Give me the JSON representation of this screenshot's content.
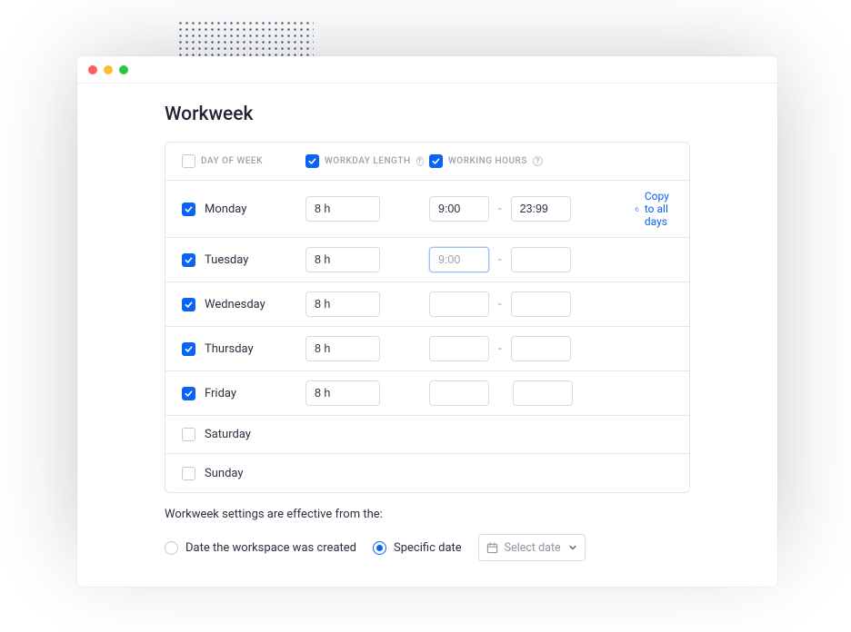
{
  "title": "Workweek",
  "columns": {
    "day": "DAY OF WEEK",
    "length": "WORKDAY LENGTH",
    "hours": "WORKING HOURS"
  },
  "header_checks": {
    "day": false,
    "length": true,
    "hours": true
  },
  "days": [
    {
      "name": "Monday",
      "checked": true,
      "length": "8 h",
      "start": "9:00",
      "end": "23:99",
      "copy": true,
      "placeholder_start": "",
      "focused": false
    },
    {
      "name": "Tuesday",
      "checked": true,
      "length": "8 h",
      "start": "",
      "end": "",
      "copy": false,
      "placeholder_start": "9:00",
      "focused": true
    },
    {
      "name": "Wednesday",
      "checked": true,
      "length": "8 h",
      "start": "",
      "end": "",
      "copy": false,
      "placeholder_start": "",
      "focused": false
    },
    {
      "name": "Thursday",
      "checked": true,
      "length": "8 h",
      "start": "",
      "end": "",
      "copy": false,
      "placeholder_start": "",
      "focused": false
    },
    {
      "name": "Friday",
      "checked": true,
      "length": "8 h",
      "start": "",
      "end": "",
      "copy": false,
      "placeholder_start": "",
      "focused": false,
      "hide_dash": true
    },
    {
      "name": "Saturday",
      "checked": false
    },
    {
      "name": "Sunday",
      "checked": false
    }
  ],
  "copy_label": "Copy to all days",
  "effective": {
    "label": "Workweek settings are effective from the:",
    "options": {
      "created": "Date the workspace was created",
      "specific": "Specific date"
    },
    "selected": "specific",
    "date_placeholder": "Select date"
  }
}
